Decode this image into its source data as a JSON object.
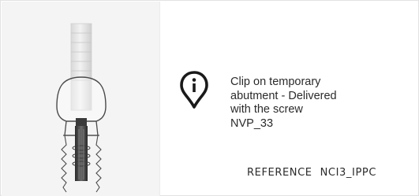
{
  "product": {
    "image": {
      "alt": "Clip on temporary abutment with screw"
    },
    "icon": "info-pin-icon",
    "description_lines": [
      "Clip on temporary",
      "abutment - Delivered",
      "with the screw",
      "NVP_33"
    ],
    "reference": {
      "label": "REFERENCE",
      "code": "NCI3_IPPC"
    }
  },
  "colors": {
    "text": "#2b2b2b",
    "icon": "#1a1a1a",
    "image_bg": "#f4f4f4",
    "metal": "#4a4a4a"
  }
}
